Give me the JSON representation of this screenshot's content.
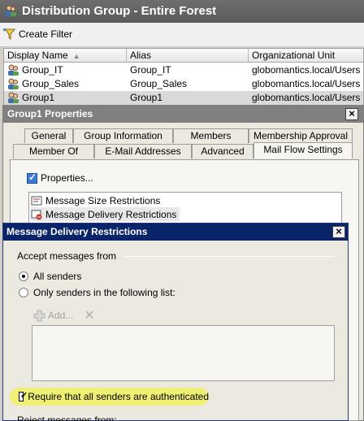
{
  "console": {
    "title": "Distribution Group - Entire Forest",
    "create_filter": "Create Filter",
    "columns": [
      "Display Name",
      "Alias",
      "Organizational Unit"
    ],
    "rows": [
      {
        "display_name": "Group_IT",
        "alias": "Group_IT",
        "ou": "globomantics.local/Users"
      },
      {
        "display_name": "Group_Sales",
        "alias": "Group_Sales",
        "ou": "globomantics.local/Users"
      },
      {
        "display_name": "Group1",
        "alias": "Group1",
        "ou": "globomantics.local/Users"
      }
    ]
  },
  "properties": {
    "title": "Group1 Properties",
    "tabs_row1": [
      "General",
      "Group Information",
      "Members",
      "Membership Approval"
    ],
    "tabs_row2": [
      "Member Of",
      "E-Mail Addresses",
      "Advanced",
      "Mail Flow Settings"
    ],
    "active_tab": "Mail Flow Settings",
    "properties_button": "Properties...",
    "restrictions": [
      "Message Size Restrictions",
      "Message Delivery Restrictions"
    ]
  },
  "delivery_dialog": {
    "title": "Message Delivery Restrictions",
    "accept_label": "Accept messages from",
    "all_senders": "All senders",
    "only_senders": "Only senders in the following list:",
    "add_label": "Add...",
    "require_auth": "Require that all senders are authenticated",
    "require_auth_checked": true,
    "reject_label": "Reject messages from:"
  },
  "colors": {
    "highlight": "#f0f075",
    "dialog_title": "#0a246a"
  }
}
